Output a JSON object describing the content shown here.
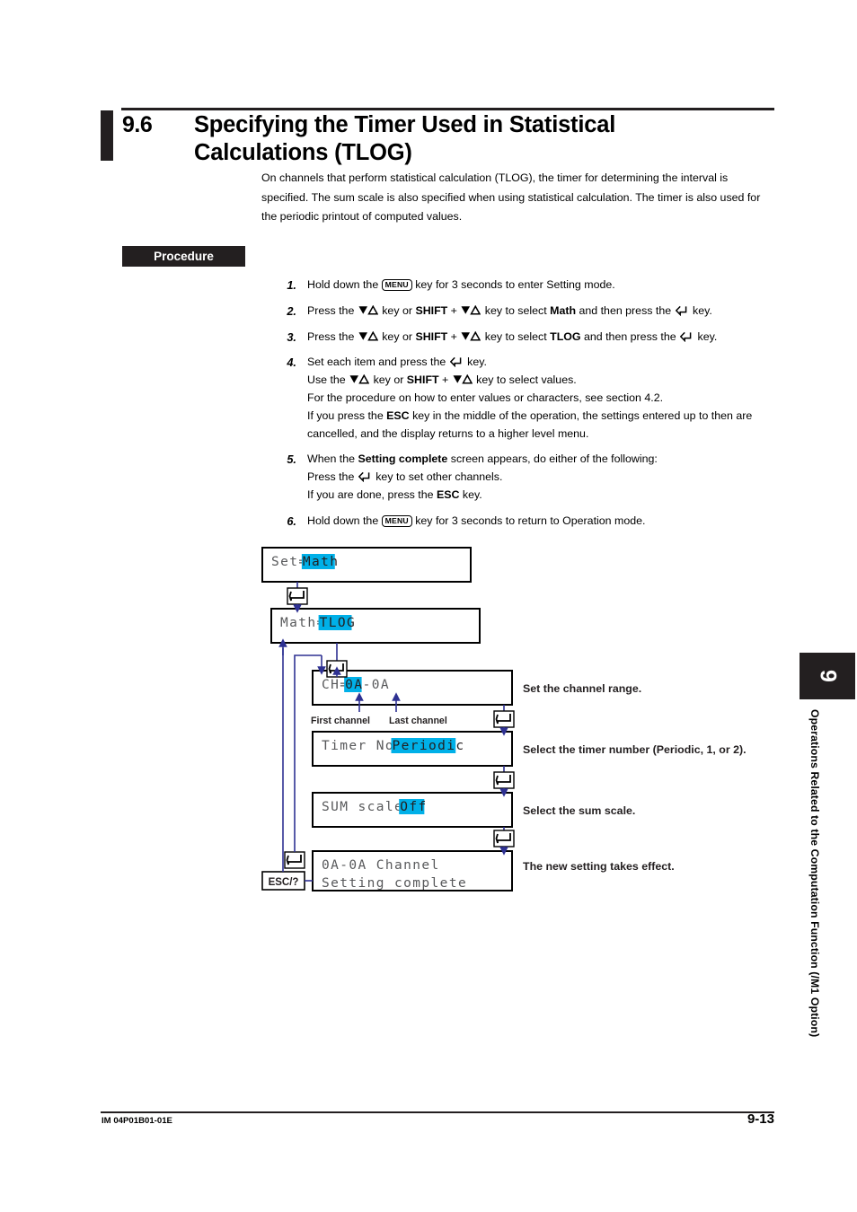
{
  "section": {
    "number": "9.6",
    "title": "Specifying the Timer Used in Statistical Calculations (TLOG)",
    "intro": "On channels that perform statistical calculation (TLOG), the timer for determining the interval is specified. The sum scale is also specified when using statistical calculation. The timer is also used for the periodic printout of computed values."
  },
  "procedure": {
    "badge": "Procedure",
    "steps": [
      {
        "number": "1.",
        "parts": [
          {
            "t": "text",
            "v": "Hold down the "
          },
          {
            "t": "key-menu",
            "v": "MENU"
          },
          {
            "t": "text",
            "v": " key for 3 seconds to enter Setting mode."
          }
        ]
      },
      {
        "number": "2.",
        "parts": [
          {
            "t": "text",
            "v": "Press the "
          },
          {
            "t": "key-tri",
            "v": "down-up-triangle"
          },
          {
            "t": "text",
            "v": " key or "
          },
          {
            "t": "bold",
            "v": "SHIFT"
          },
          {
            "t": "text",
            "v": " + "
          },
          {
            "t": "key-tri",
            "v": "down-up-triangle"
          },
          {
            "t": "text",
            "v": " key to select "
          },
          {
            "t": "bold",
            "v": "Math"
          },
          {
            "t": "text",
            "v": " and then press the "
          },
          {
            "t": "key-ent",
            "v": "enter-arrow"
          },
          {
            "t": "text",
            "v": " key."
          }
        ]
      },
      {
        "number": "3.",
        "parts": [
          {
            "t": "text",
            "v": "Press the "
          },
          {
            "t": "key-tri",
            "v": "down-up-triangle"
          },
          {
            "t": "text",
            "v": " key or "
          },
          {
            "t": "bold",
            "v": "SHIFT"
          },
          {
            "t": "text",
            "v": " + "
          },
          {
            "t": "key-tri",
            "v": "down-up-triangle"
          },
          {
            "t": "text",
            "v": " key to select "
          },
          {
            "t": "bold",
            "v": "TLOG"
          },
          {
            "t": "text",
            "v": " and then press the "
          },
          {
            "t": "key-ent",
            "v": "enter-arrow"
          },
          {
            "t": "text",
            "v": " key."
          }
        ]
      },
      {
        "number": "4.",
        "parts": [
          {
            "t": "text",
            "v": "Set each item and press the "
          },
          {
            "t": "key-ent",
            "v": "enter-arrow"
          },
          {
            "t": "text",
            "v": " key."
          },
          {
            "t": "br"
          },
          {
            "t": "text",
            "v": "Use the "
          },
          {
            "t": "key-tri",
            "v": "down-up-triangle"
          },
          {
            "t": "text",
            "v": " key or "
          },
          {
            "t": "bold",
            "v": "SHIFT"
          },
          {
            "t": "text",
            "v": " + "
          },
          {
            "t": "key-tri",
            "v": "down-up-triangle"
          },
          {
            "t": "text",
            "v": " key to select values."
          },
          {
            "t": "br"
          },
          {
            "t": "text",
            "v": "For the procedure on how to enter values or characters, see section 4.2."
          },
          {
            "t": "br"
          },
          {
            "t": "text",
            "v": "If you press the "
          },
          {
            "t": "bold",
            "v": "ESC"
          },
          {
            "t": "text",
            "v": " key in the middle of the operation, the settings entered up to then are cancelled, and the display returns to a higher level menu."
          }
        ]
      },
      {
        "number": "5.",
        "parts": [
          {
            "t": "text",
            "v": "When the "
          },
          {
            "t": "bold",
            "v": "Setting complete"
          },
          {
            "t": "text",
            "v": " screen appears, do either of the following:"
          },
          {
            "t": "br"
          },
          {
            "t": "text",
            "v": "Press the "
          },
          {
            "t": "key-ent",
            "v": "enter-arrow"
          },
          {
            "t": "text",
            "v": " key to set other channels."
          },
          {
            "t": "br"
          },
          {
            "t": "text",
            "v": "If you are done, press the "
          },
          {
            "t": "bold",
            "v": "ESC"
          },
          {
            "t": "text",
            "v": " key."
          }
        ]
      },
      {
        "number": "6.",
        "parts": [
          {
            "t": "text",
            "v": "Hold down the "
          },
          {
            "t": "key-menu",
            "v": "MENU"
          },
          {
            "t": "text",
            "v": " key for 3 seconds to return to Operation mode."
          }
        ]
      }
    ]
  },
  "flow": {
    "highlight_color": "#00b0e8",
    "screen_text_color": "#58595b",
    "line_color": "#2e3192",
    "screens": [
      {
        "id": "set",
        "label": "Set=",
        "value": "Math"
      },
      {
        "id": "math",
        "label": "Math=",
        "value": "TLOG"
      },
      {
        "id": "ch",
        "label": "CH=",
        "value": "0A",
        "suffix": "-0A"
      },
      {
        "id": "timer",
        "label": "Timer No=",
        "value": "Periodic"
      },
      {
        "id": "sum",
        "label": "SUM scale=",
        "value": "Off"
      },
      {
        "id": "done",
        "line1": "0A-0A Channel",
        "line2": "Setting complete"
      }
    ],
    "notes": [
      "Set the channel range.",
      "Select the timer number (Periodic, 1, or 2).",
      "Select the sum scale.",
      "The new setting takes effect."
    ],
    "callouts": [
      "First channel",
      "Last channel"
    ],
    "esc_key": "ESC/?"
  },
  "side_tab": {
    "number": "9",
    "label": "Operations Related to the Computation Function (/M1 Option)"
  },
  "footer": {
    "doc_id": "IM 04P01B01-01E",
    "page": "9-13"
  }
}
